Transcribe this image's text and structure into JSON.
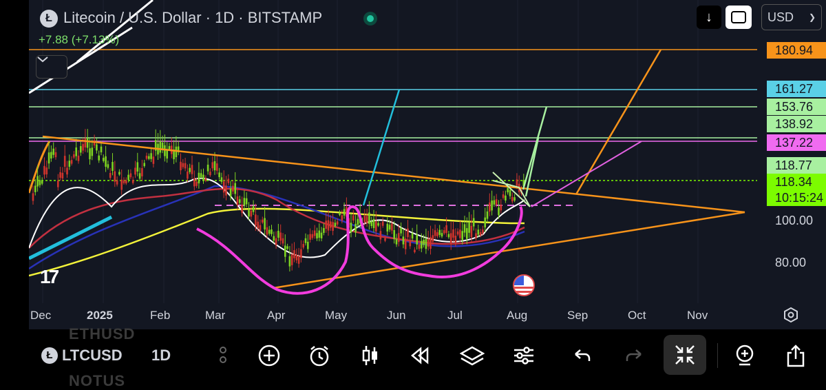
{
  "header": {
    "title": "Litecoin / U.S. Dollar · 1D · BITSTAMP",
    "change": "+7.88 (+7.13%)",
    "currency": "USD"
  },
  "price_labels": [
    {
      "value": "180.94",
      "color": "#f7931a"
    },
    {
      "value": "161.27",
      "color": "#5ad0e6"
    },
    {
      "value": "153.76",
      "color": "#a8f0a0"
    },
    {
      "value": "138.92",
      "color": "#a8f0a0"
    },
    {
      "value": "137.22",
      "color": "#f06bf0"
    },
    {
      "value": "118.77",
      "color": "#a8f0a0"
    },
    {
      "value": "118.34",
      "color": "#7cfc00"
    },
    {
      "value": "10:15:24",
      "color": "#7cfc00"
    },
    {
      "value": "100.00",
      "color": ""
    },
    {
      "value": "80.00",
      "color": ""
    }
  ],
  "x_axis": [
    "Dec",
    "2025",
    "Feb",
    "Mar",
    "Apr",
    "May",
    "Jun",
    "Jul",
    "Aug",
    "Sep",
    "Oct",
    "Nov"
  ],
  "toolbar": {
    "symbol": "LTCUSD",
    "interval": "1D",
    "ghost_above": "ETHUSD",
    "ghost_below": "NOTUS"
  },
  "icons": [
    "litecoin-icon",
    "download-icon",
    "fullscreen-icon",
    "chevron-down-icon",
    "settings-icon",
    "add-icon",
    "alert-icon",
    "candles-icon",
    "replay-icon",
    "layers-icon",
    "adjust-icon",
    "undo-icon",
    "redo-icon",
    "collapse-icon",
    "add-indicator-icon",
    "share-icon"
  ]
}
